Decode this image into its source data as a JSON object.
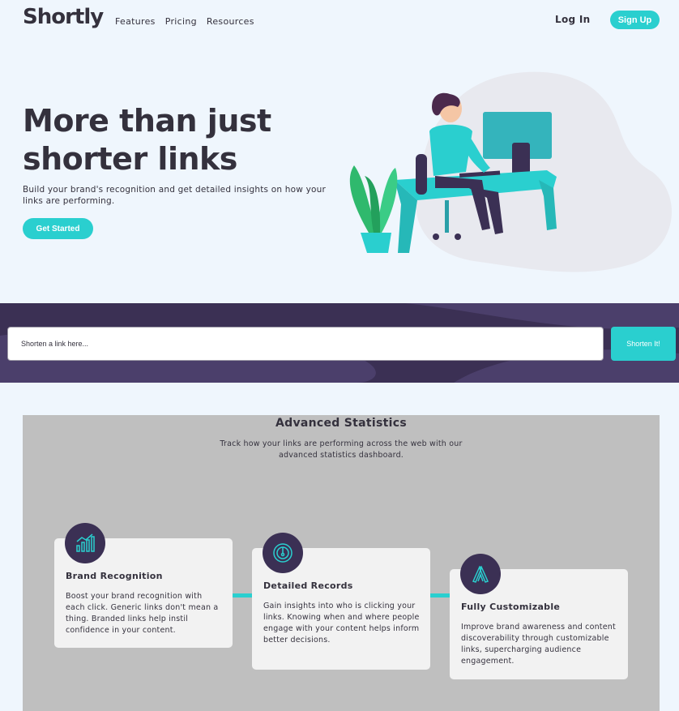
{
  "header": {
    "logo": "Shortly",
    "nav": [
      "Features",
      "Pricing",
      "Resources"
    ],
    "login_label": "Log In",
    "signup_label": "Sign Up"
  },
  "hero": {
    "title": "More than just shorter links",
    "subtitle": "Build your brand's recognition and get detailed insights on how your links are performing.",
    "cta_label": "Get Started"
  },
  "shorten": {
    "placeholder": "Shorten a link here...",
    "button_label": "Shorten It!"
  },
  "stats": {
    "title": "Advanced Statistics",
    "subtitle": "Track how your links are performing across the web with our advanced statistics dashboard.",
    "cards": [
      {
        "icon": "brand-recognition-icon",
        "title": "Brand Recognition",
        "text": "Boost your brand recognition with each click. Generic links don't mean a thing. Branded links help instil confidence in your content."
      },
      {
        "icon": "detailed-records-icon",
        "title": "Detailed Records",
        "text": "Gain insights into who is clicking your links. Knowing when and where people engage with your content helps inform better decisions."
      },
      {
        "icon": "fully-customizable-icon",
        "title": "Fully Customizable",
        "text": "Improve brand awareness and content discoverability through customizable links, supercharging audience engagement."
      }
    ]
  },
  "colors": {
    "accent": "#2acfcf",
    "dark_violet": "#3b3054",
    "background": "#eff6fd",
    "section_gray": "#bfbfbf"
  }
}
